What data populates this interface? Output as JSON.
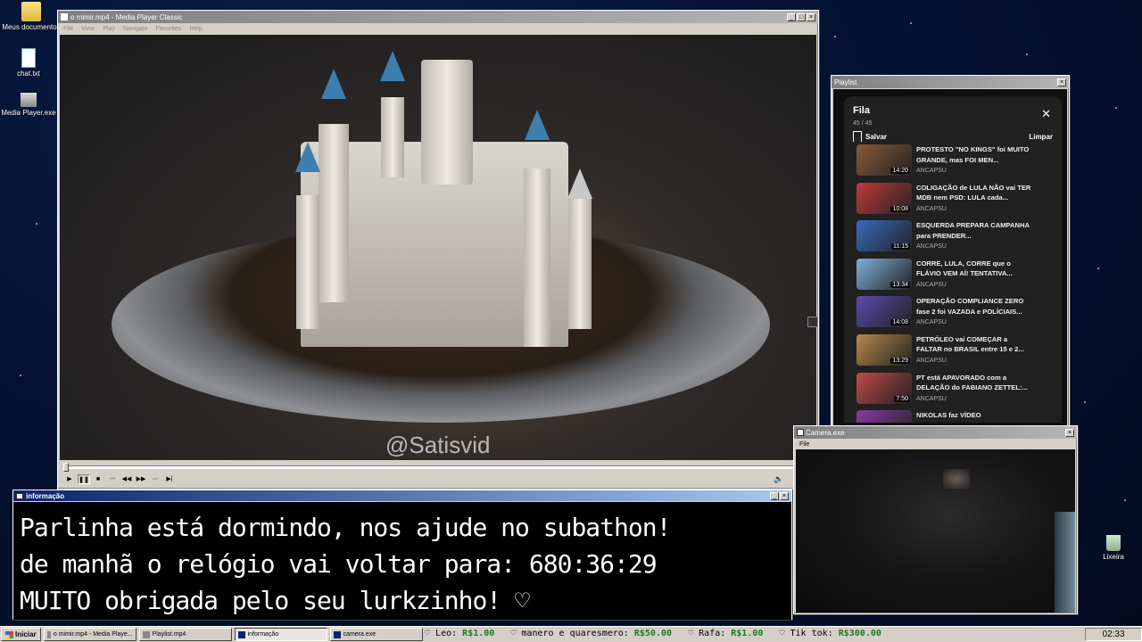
{
  "desktop": {
    "icons": [
      {
        "label": "Meus documentos"
      },
      {
        "label": "chat.txt"
      },
      {
        "label": "Media Player.exe"
      },
      {
        "label": "Lixeira"
      }
    ]
  },
  "player": {
    "title": "o mimir.mp4 - Media Player Classic",
    "menu": [
      "File",
      "View",
      "Play",
      "Navigate",
      "Favorites",
      "Help"
    ],
    "watermark": "@Satisvid"
  },
  "playlist_window": {
    "title": "Playlist",
    "header": "Fila",
    "count": "45 / 45",
    "save_label": "Salvar",
    "clear_label": "Limpar",
    "items": [
      {
        "title": "PROTESTO \"NO KINGS\" foi MUITO GRANDE, mas FOI MEN...",
        "channel": "ANCAPSU",
        "duration": "14:20",
        "color": "#8a5a3a"
      },
      {
        "title": "COLIGAÇÃO de LULA NÃO vai TER MDB nem PSD: LULA cada...",
        "channel": "ANCAPSU",
        "duration": "10:08",
        "color": "#c23a3a"
      },
      {
        "title": "ESQUERDA PREPARA CAMPANHA para PRENDER...",
        "channel": "ANCAPSU",
        "duration": "11:15",
        "color": "#3a6ac2"
      },
      {
        "title": "CORRE, LULA, CORRE que o FLÁVIO VEM AÍ! TENTATIVA...",
        "channel": "ANCAPSU",
        "duration": "13:34",
        "color": "#7fb0d8"
      },
      {
        "title": "OPERAÇÃO COMPLIANCE ZERO fase 2 foi VAZADA e POLÍCIAIS...",
        "channel": "ANCAPSU",
        "duration": "14:08",
        "color": "#5a4ab2"
      },
      {
        "title": "PETRÓLEO vai COMEÇAR a FALTAR no BRASIL entre 15 e 2...",
        "channel": "ANCAPSU",
        "duration": "13:29",
        "color": "#b88a4a"
      },
      {
        "title": "PT está APAVORADO com a DELAÇÃO do FABIANO ZETTEL:...",
        "channel": "ANCAPSU",
        "duration": "7:50",
        "color": "#c24a4a"
      },
      {
        "title": "NIKOLAS faz VÍDEO",
        "channel": "",
        "duration": "",
        "color": "#8a3aa2"
      }
    ]
  },
  "camera_window": {
    "title": "Camera.exe",
    "menu": [
      "File"
    ]
  },
  "info_window": {
    "title": "informação",
    "lines": [
      "Parlinha está dormindo, nos ajude no subathon!",
      "de manhã o relógio vai voltar para:  680:36:29",
      "MUITO obrigada pelo seu lurkzinho! ♡"
    ]
  },
  "taskbar": {
    "start_label": "Iniciar",
    "tasks": [
      {
        "label": "o mimir.mp4 - Media Playe..."
      },
      {
        "label": "Playlist.mp4"
      },
      {
        "label": "informação"
      },
      {
        "label": "camera.exe"
      }
    ],
    "ticker": [
      {
        "name": "Leo:",
        "amount": "R$1.00"
      },
      {
        "name": "manero e quaresmero:",
        "amount": "R$50.00"
      },
      {
        "name": "Rafa:",
        "amount": "R$1.00"
      },
      {
        "name": "Tik tok:",
        "amount": "R$300.00"
      }
    ],
    "clock": "02:33"
  }
}
